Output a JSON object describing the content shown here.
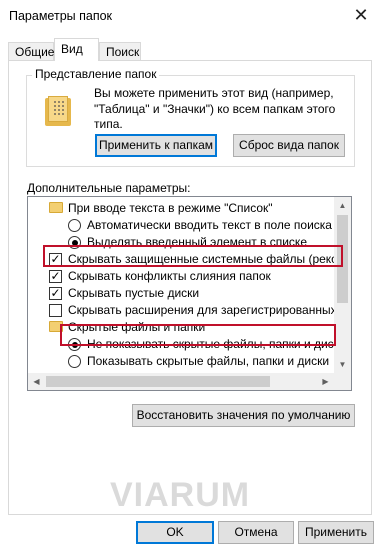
{
  "window": {
    "title": "Параметры папок",
    "close_glyph": "✕"
  },
  "tabs": [
    {
      "label": "Общие",
      "active": false
    },
    {
      "label": "Вид",
      "active": true
    },
    {
      "label": "Поиск",
      "active": false
    }
  ],
  "folder_view": {
    "legend": "Представление папок",
    "description": "Вы можете применить этот вид (например, \"Таблица\" и \"Значки\") ко всем папкам этого типа.",
    "apply_button": "Применить к папкам",
    "reset_button": "Сброс вида папок"
  },
  "advanced": {
    "label": "Дополнительные параметры:",
    "items": [
      {
        "kind": "folder",
        "text": "При вводе текста в режиме \"Список\""
      },
      {
        "kind": "radio",
        "checked": false,
        "text": "Автоматически вводить текст в поле поиска"
      },
      {
        "kind": "radio",
        "checked": true,
        "text": "Выделять введенный элемент в списке"
      },
      {
        "kind": "checkbox",
        "checked": true,
        "text": "Скрывать защищенные системные файлы (рекомен,"
      },
      {
        "kind": "checkbox",
        "checked": true,
        "text": "Скрывать конфликты слияния папок"
      },
      {
        "kind": "checkbox",
        "checked": true,
        "text": "Скрывать пустые диски"
      },
      {
        "kind": "checkbox",
        "checked": false,
        "text": "Скрывать расширения для зарегистрированных типо"
      },
      {
        "kind": "folder",
        "text": "Скрытые файлы и папки"
      },
      {
        "kind": "radio",
        "checked": true,
        "text": "Не показывать скрытые файлы, папки и диски"
      },
      {
        "kind": "radio",
        "checked": false,
        "text": "Показывать скрытые файлы, папки и диски"
      }
    ],
    "restore_button": "Восстановить значения по умолчанию"
  },
  "footer": {
    "ok_button": "OK",
    "cancel_button": "Отмена",
    "apply_button": "Применить"
  },
  "watermark": "VIARUM",
  "colors": {
    "highlight": "#c0102a",
    "default_button_border": "#0078d7"
  }
}
